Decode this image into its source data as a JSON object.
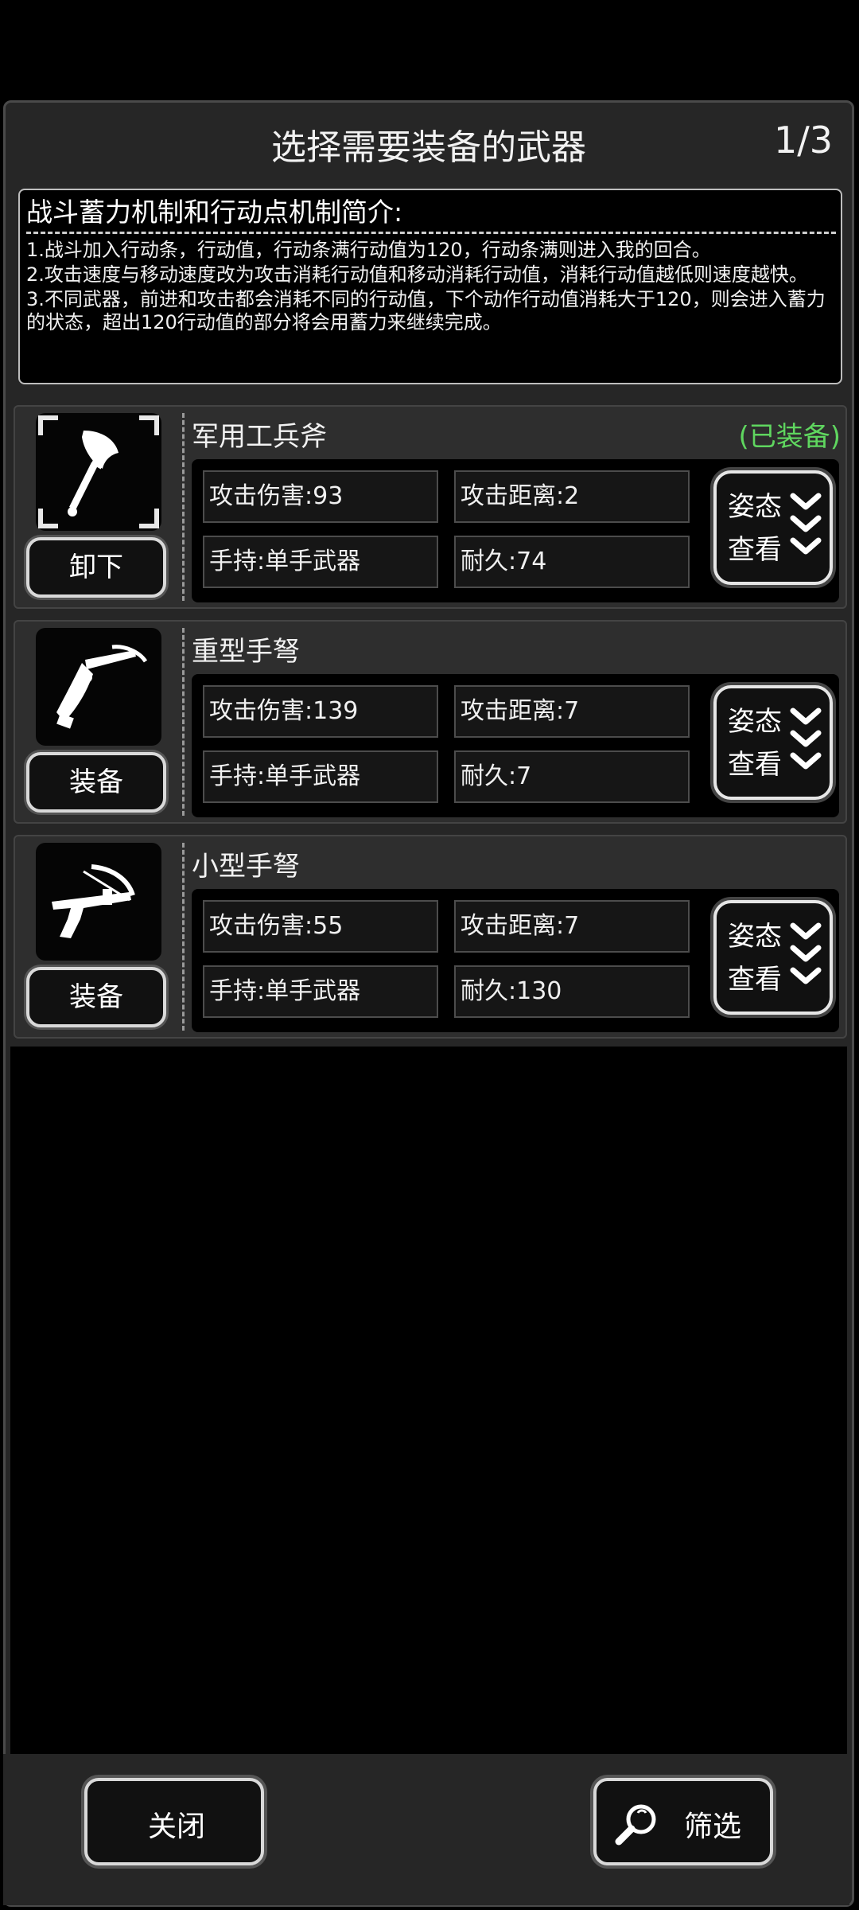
{
  "header": {
    "title": "选择需要装备的武器",
    "page": "1/3"
  },
  "intro": {
    "heading": "战斗蓄力机制和行动点机制简介:",
    "lines": [
      "1.战斗加入行动条，行动值，行动条满行动值为120，行动条满则进入我的回合。",
      "2.攻击速度与移动速度改为攻击消耗行动值和移动消耗行动值，消耗行动值越低则速度越快。",
      "3.不同武器，前进和攻击都会消耗不同的行动值，下个动作行动值消耗大于120，则会进入蓄力的状态，超出120行动值的部分将会用蓄力来继续完成。"
    ]
  },
  "weapons": [
    {
      "name": "军用工兵斧",
      "status": "(已装备)",
      "icon": "axe-icon",
      "action": "卸下",
      "damage": "攻击伤害:93",
      "range": "攻击距离:2",
      "hand": "手持:单手武器",
      "durability": "耐久:74",
      "view_l1": "姿态",
      "view_l2": "查看"
    },
    {
      "name": "重型手弩",
      "status": "",
      "icon": "heavy-crossbow-icon",
      "action": "装备",
      "damage": "攻击伤害:139",
      "range": "攻击距离:7",
      "hand": "手持:单手武器",
      "durability": "耐久:7",
      "view_l1": "姿态",
      "view_l2": "查看"
    },
    {
      "name": "小型手弩",
      "status": "",
      "icon": "small-crossbow-icon",
      "action": "装备",
      "damage": "攻击伤害:55",
      "range": "攻击距离:7",
      "hand": "手持:单手武器",
      "durability": "耐久:130",
      "view_l1": "姿态",
      "view_l2": "查看"
    }
  ],
  "footer": {
    "close_label": "关闭",
    "filter_label": "筛选",
    "filter_icon": "search-icon"
  },
  "colors": {
    "equipped": "#5fd65f",
    "panel": "#262626",
    "background": "#000000"
  }
}
